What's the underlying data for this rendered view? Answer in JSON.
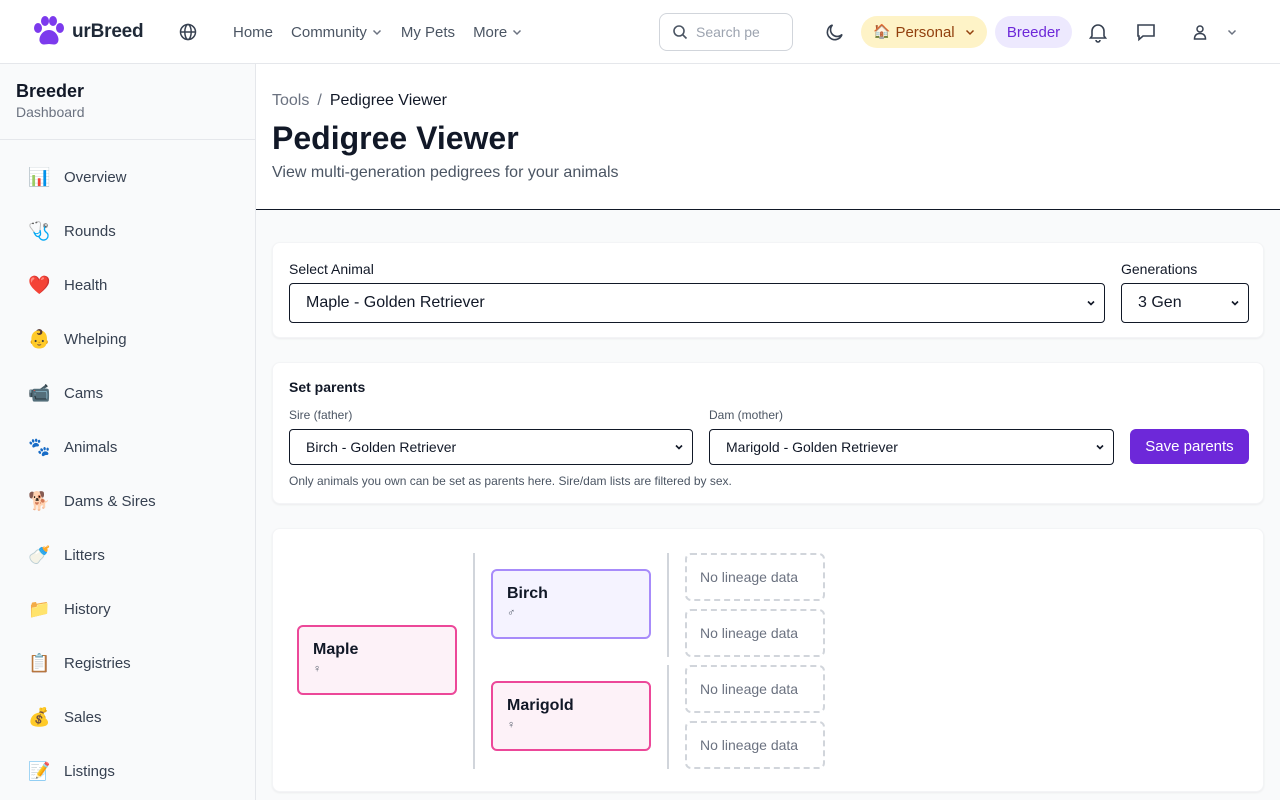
{
  "app": {
    "brand": "urBreed",
    "accent": "#6d28d9"
  },
  "nav": {
    "links": [
      "Home",
      "Community",
      "My Pets",
      "More"
    ],
    "search_placeholder": "Search pe",
    "personal_label": "Personal",
    "personal_emoji": "🏠",
    "breeder_label": "Breeder"
  },
  "sidebar": {
    "title": "Breeder",
    "subtitle": "Dashboard",
    "items": [
      {
        "emoji": "📊",
        "label": "Overview"
      },
      {
        "emoji": "🩺",
        "label": "Rounds"
      },
      {
        "emoji": "❤️",
        "label": "Health"
      },
      {
        "emoji": "👶",
        "label": "Whelping"
      },
      {
        "emoji": "📹",
        "label": "Cams"
      },
      {
        "emoji": "🐾",
        "label": "Animals"
      },
      {
        "emoji": "🐕",
        "label": "Dams & Sires"
      },
      {
        "emoji": "🍼",
        "label": "Litters"
      },
      {
        "emoji": "📁",
        "label": "History"
      },
      {
        "emoji": "📋",
        "label": "Registries"
      },
      {
        "emoji": "💰",
        "label": "Sales"
      },
      {
        "emoji": "📝",
        "label": "Listings"
      }
    ]
  },
  "page": {
    "breadcrumb_root": "Tools",
    "breadcrumb_sep": "/",
    "breadcrumb_current": "Pedigree Viewer",
    "title": "Pedigree Viewer",
    "subtitle": "View multi-generation pedigrees for your animals"
  },
  "select_panel": {
    "animal_label": "Select Animal",
    "animal_value": "Maple - Golden Retriever",
    "generations_label": "Generations",
    "generations_value": "3 Gen"
  },
  "parents_panel": {
    "heading": "Set parents",
    "sire_label": "Sire (father)",
    "sire_value": "Birch - Golden Retriever",
    "dam_label": "Dam (mother)",
    "dam_value": "Marigold - Golden Retriever",
    "save_label": "Save parents",
    "hint": "Only animals you own can be set as parents here. Sire/dam lists are filtered by sex."
  },
  "pedigree": {
    "subject": {
      "name": "Maple",
      "sex": "♀"
    },
    "sire": {
      "name": "Birch",
      "sex": "♂"
    },
    "dam": {
      "name": "Marigold",
      "sex": "♀"
    },
    "empty_label": "No lineage data",
    "grandparents": [
      "No lineage data",
      "No lineage data",
      "No lineage data",
      "No lineage data"
    ]
  }
}
